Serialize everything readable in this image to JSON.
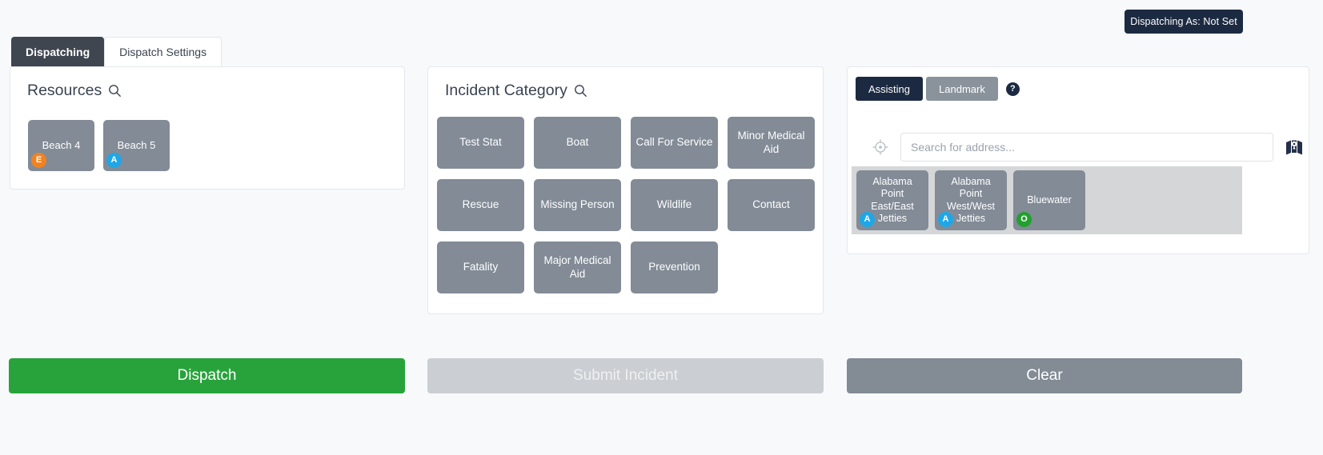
{
  "header": {
    "dispatching_as": "Dispatching As: Not Set"
  },
  "tabs": [
    {
      "label": "Dispatching",
      "active": true
    },
    {
      "label": "Dispatch Settings",
      "active": false
    }
  ],
  "resources_panel": {
    "title": "Resources",
    "search_icon": "search-icon",
    "items": [
      {
        "label": "Beach 4",
        "badge": "E",
        "badge_color": "#f28220"
      },
      {
        "label": "Beach 5",
        "badge": "A",
        "badge_color": "#1ea7e8"
      }
    ]
  },
  "incident_panel": {
    "title": "Incident Category",
    "search_icon": "search-icon",
    "categories": [
      "Test Stat",
      "Boat",
      "Call For Service",
      "Minor Medical Aid",
      "Rescue",
      "Missing Person",
      "Wildlife",
      "Contact",
      "Fatality",
      "Major Medical Aid",
      "Prevention"
    ]
  },
  "location_panel": {
    "segments": [
      {
        "label": "Assisting",
        "selected": true
      },
      {
        "label": "Landmark",
        "selected": false
      }
    ],
    "help_label": "?",
    "locate_icon": "crosshair-icon",
    "map_icon": "map-icon",
    "search": {
      "value": "",
      "placeholder": "Search for address..."
    },
    "landmarks": [
      {
        "label": "Alabama Point East/East Jetties",
        "badge": "A",
        "badge_color": "#1ea7e8"
      },
      {
        "label": "Alabama Point West/West Jetties",
        "badge": "A",
        "badge_color": "#1ea7e8"
      },
      {
        "label": "Bluewater",
        "badge": "O",
        "badge_color": "#22a02e"
      }
    ]
  },
  "actions": {
    "dispatch": "Dispatch",
    "submit": "Submit Incident",
    "clear": "Clear"
  },
  "colors": {
    "accent_dark": "#1c2a41",
    "tile": "#828b96",
    "dispatch_green": "#28a33c",
    "submit_disabled": "#cbced2",
    "clear_gray": "#838b95",
    "page_bg": "#f7f9fb"
  }
}
